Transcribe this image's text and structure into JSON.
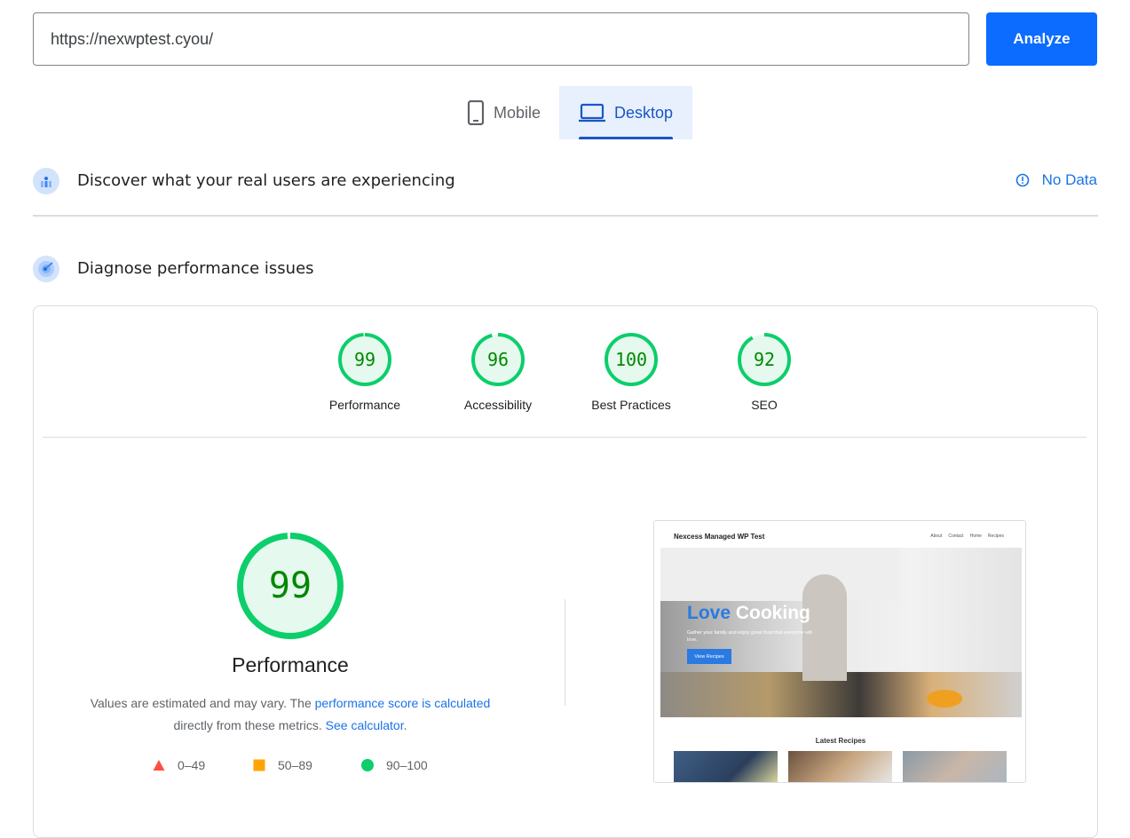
{
  "search": {
    "url": "https://nexwptest.cyou/",
    "analyze_label": "Analyze"
  },
  "tabs": [
    {
      "label": "Mobile",
      "icon": "smartphone-icon"
    },
    {
      "label": "Desktop",
      "icon": "laptop-icon",
      "selected": true
    }
  ],
  "field_data": {
    "title": "Discover what your real users are experiencing",
    "status": "No Data"
  },
  "lab": {
    "title": "Diagnose performance issues"
  },
  "scores": [
    {
      "label": "Performance",
      "value": 99
    },
    {
      "label": "Accessibility",
      "value": 96
    },
    {
      "label": "Best Practices",
      "value": 100
    },
    {
      "label": "SEO",
      "value": 92
    }
  ],
  "main_score": {
    "value": 99,
    "label": "Performance",
    "desc_1": "Values are estimated and may vary. The ",
    "link_1": "performance score is calculated",
    "desc_2": " directly from these metrics. ",
    "link_2": "See calculator",
    "desc_3": "."
  },
  "legend": [
    {
      "range": "0–49",
      "color": "#ff4e42"
    },
    {
      "range": "50–89",
      "color": "#ffa400"
    },
    {
      "range": "90–100",
      "color": "#0cce6b"
    }
  ],
  "colors": {
    "good": "#0cce6b",
    "good_text": "#008800",
    "good_bg": "#e6f9ee",
    "accent": "#0b6cff"
  },
  "screenshot": {
    "site_title": "Nexcess Managed WP Test",
    "nav": [
      "About",
      "Contact",
      "Home",
      "Recipes"
    ],
    "hero_word_1": "Love",
    "hero_word_2": "Cooking",
    "hero_sub": "Gather your family and enjoy great food that everyone will love.",
    "hero_button": "View Recipes",
    "section_title": "Latest Recipes"
  }
}
